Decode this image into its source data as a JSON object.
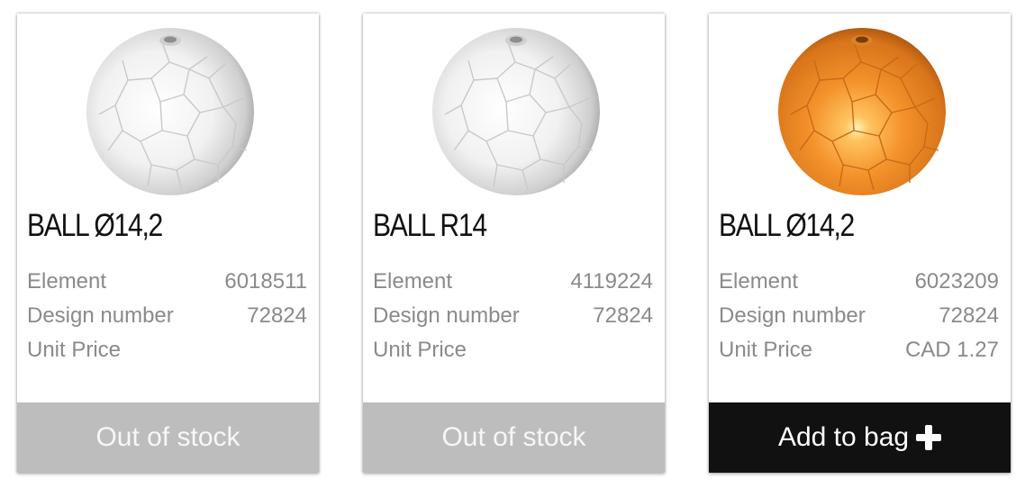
{
  "products": [
    {
      "name": "BALL Ø14,2",
      "color": "#f2f2f2",
      "image_icon": "white-soccer-ball",
      "specs": [
        {
          "label": "Element",
          "value": "6018511"
        },
        {
          "label": "Design number",
          "value": "72824"
        },
        {
          "label": "Unit Price",
          "value": ""
        }
      ],
      "action_label": "Out of stock",
      "action_state": "out-of-stock"
    },
    {
      "name": "BALL R14",
      "color": "#f2f2f2",
      "image_icon": "white-soccer-ball",
      "specs": [
        {
          "label": "Element",
          "value": "4119224"
        },
        {
          "label": "Design number",
          "value": "72824"
        },
        {
          "label": "Unit Price",
          "value": ""
        }
      ],
      "action_label": "Out of stock",
      "action_state": "out-of-stock"
    },
    {
      "name": "BALL Ø14,2",
      "color": "#f5902a",
      "image_icon": "orange-soccer-ball",
      "specs": [
        {
          "label": "Element",
          "value": "6023209"
        },
        {
          "label": "Design number",
          "value": "72824"
        },
        {
          "label": "Unit Price",
          "value": "CAD 1.27"
        }
      ],
      "action_label": "Add to bag",
      "action_icon": "plus-icon",
      "action_state": "available"
    }
  ],
  "colors": {
    "out_of_stock_button": "#bdbdbd",
    "add_button": "#111111",
    "spec_text": "#8a8a8a"
  }
}
